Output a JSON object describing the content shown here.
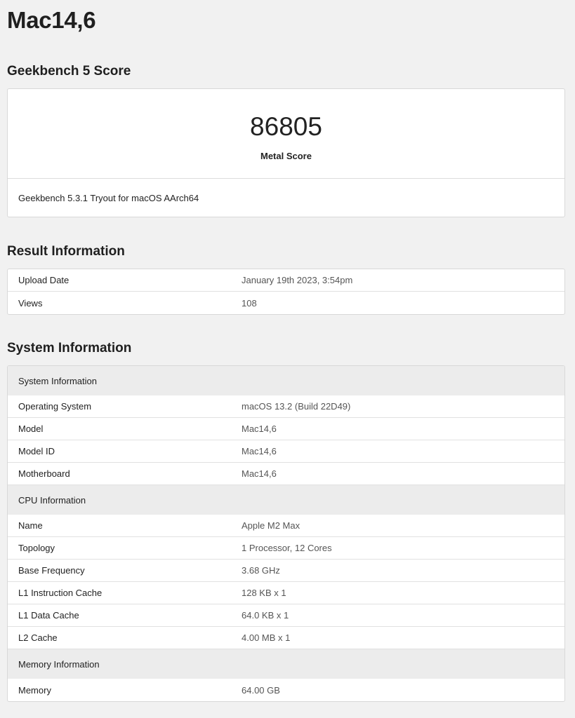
{
  "device_title": "Mac14,6",
  "score_section": {
    "title": "Geekbench 5 Score",
    "value": "86805",
    "label": "Metal Score",
    "footer": "Geekbench 5.3.1 Tryout for macOS AArch64"
  },
  "result_section": {
    "title": "Result Information",
    "rows": [
      {
        "key": "Upload Date",
        "value": "January 19th 2023, 3:54pm"
      },
      {
        "key": "Views",
        "value": "108"
      }
    ]
  },
  "system_section": {
    "title": "System Information",
    "groups": [
      {
        "heading": "System Information",
        "rows": [
          {
            "key": "Operating System",
            "value": "macOS 13.2 (Build 22D49)"
          },
          {
            "key": "Model",
            "value": "Mac14,6"
          },
          {
            "key": "Model ID",
            "value": "Mac14,6"
          },
          {
            "key": "Motherboard",
            "value": "Mac14,6"
          }
        ]
      },
      {
        "heading": "CPU Information",
        "rows": [
          {
            "key": "Name",
            "value": "Apple M2 Max"
          },
          {
            "key": "Topology",
            "value": "1 Processor, 12 Cores"
          },
          {
            "key": "Base Frequency",
            "value": "3.68 GHz"
          },
          {
            "key": "L1 Instruction Cache",
            "value": "128 KB x 1"
          },
          {
            "key": "L1 Data Cache",
            "value": "64.0 KB x 1"
          },
          {
            "key": "L2 Cache",
            "value": "4.00 MB x 1"
          }
        ]
      },
      {
        "heading": "Memory Information",
        "rows": [
          {
            "key": "Memory",
            "value": "64.00 GB"
          }
        ]
      }
    ]
  }
}
